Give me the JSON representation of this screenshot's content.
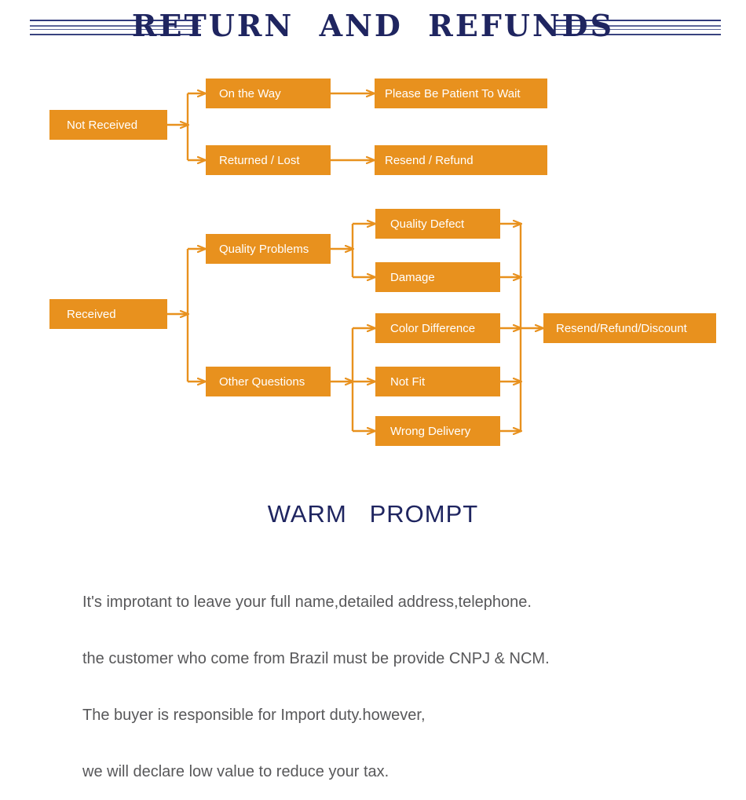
{
  "header": {
    "title": "RETURN  AND  REFUNDS",
    "rule_color": "#2b3474",
    "title_color": "#1f2560"
  },
  "theme": {
    "box_fill": "#E8911E",
    "connector": "#E8911E",
    "box_text": "#ffffff",
    "body_text": "#58585a",
    "background": "#ffffff"
  },
  "flowchart": {
    "type": "diagram",
    "branches": [
      {
        "id": "not-received",
        "root": "Not Received",
        "children": [
          {
            "label": "On the Way",
            "next": "Please Be Patient To Wait"
          },
          {
            "label": "Returned / Lost",
            "next": "Resend / Refund"
          }
        ]
      },
      {
        "id": "received",
        "root": "Received",
        "children": [
          {
            "label": "Quality Problems",
            "leaves": [
              "Quality Defect",
              "Damage"
            ]
          },
          {
            "label": "Other Questions",
            "leaves": [
              "Color Difference",
              "Not Fit",
              "Wrong Delivery"
            ]
          }
        ],
        "outcome": "Resend/Refund/Discount"
      }
    ],
    "nodes": {
      "not_received": "Not Received",
      "on_the_way": "On the Way",
      "returned_lost": "Returned / Lost",
      "please_wait": "Please Be Patient To Wait",
      "resend_refund": "Resend / Refund",
      "received": "Received",
      "quality_problems": "Quality Problems",
      "other_questions": "Other Questions",
      "quality_defect": "Quality Defect",
      "damage": "Damage",
      "color_difference": "Color Difference",
      "not_fit": "Not Fit",
      "wrong_delivery": "Wrong Delivery",
      "resend_refund_discount": "Resend/Refund/Discount"
    }
  },
  "warm_prompt": {
    "title": "WARM   PROMPT",
    "lines": [
      "It's improtant to leave your full name,detailed address,telephone.",
      "the customer who come from Brazil must be provide CNPJ & NCM.",
      "The buyer is responsible for Import duty.however,",
      "we will declare low value to reduce your tax."
    ],
    "line1": "It's improtant to leave your full name,detailed address,telephone.",
    "line2": "the customer who come from Brazil must be provide CNPJ & NCM.",
    "line3": "The buyer is responsible for Import duty.however,",
    "line4": "we will declare low value to reduce your tax."
  }
}
